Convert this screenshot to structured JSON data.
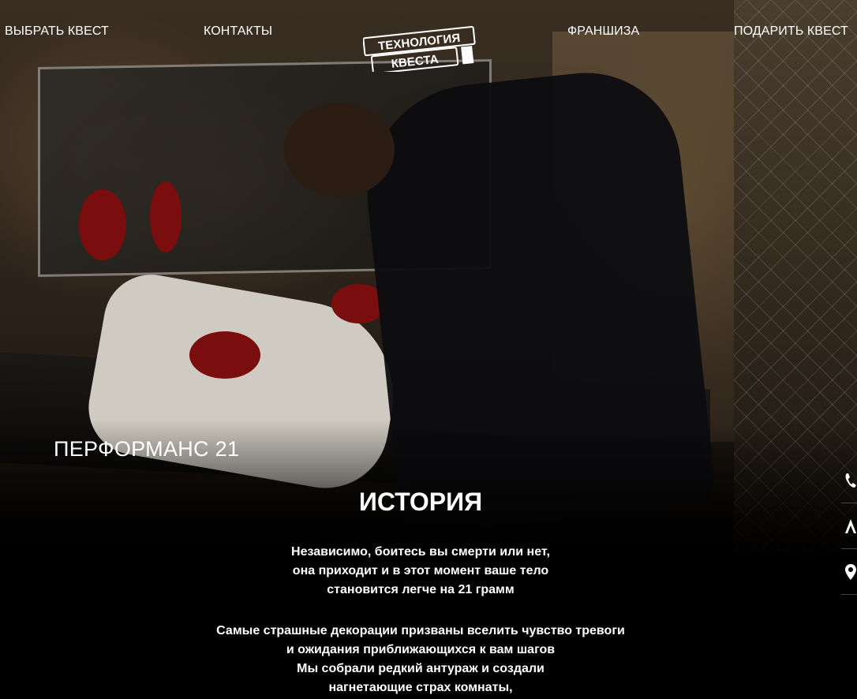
{
  "nav": {
    "choose_quest": "ВЫБРАТЬ КВЕСТ",
    "contacts": "КОНТАКТЫ",
    "franchise": "ФРАНШИЗА",
    "gift_quest": "ПОДАРИТЬ КВЕСТ"
  },
  "logo": {
    "line1": "ТЕХНОЛОГИЯ",
    "line2": "КВЕСТА"
  },
  "hero": {
    "title": "ПЕРФОРМАНС 21"
  },
  "story": {
    "heading": "ИСТОРИЯ",
    "paragraph1": [
      "Независимо, боитесь вы смерти или нет,",
      "она приходит и в этот момент ваше тело",
      "становится легче на 21 грамм"
    ],
    "paragraph2": [
      "Самые страшные декорации призваны вселить чувство тревоги",
      "и ожидания приближающихся к вам шагов",
      "Мы собрали редкий антураж и создали",
      "нагнетающие страх комнаты,"
    ]
  },
  "side_icons": [
    "phone-icon",
    "user-icon",
    "map-pin-icon"
  ],
  "colors": {
    "text": "#ffffff",
    "background": "#000000",
    "blood": "#7a0d0d"
  }
}
